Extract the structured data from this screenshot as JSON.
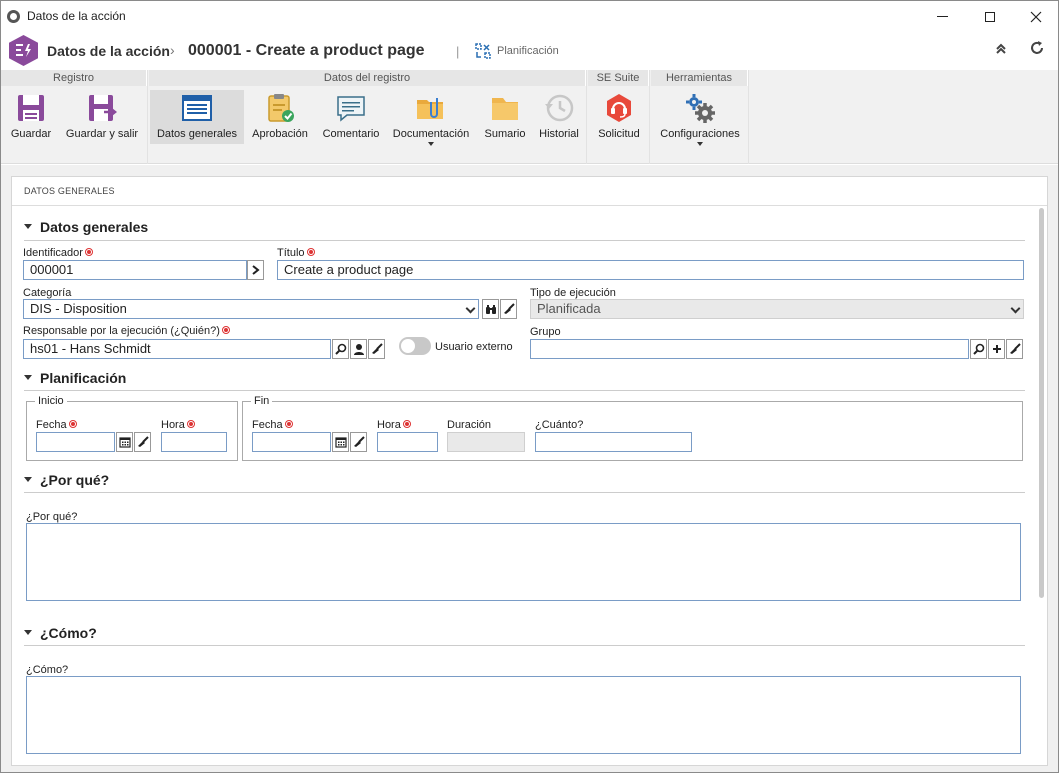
{
  "window": {
    "title": "Datos de la acción"
  },
  "header": {
    "crumb": "Datos de la acción",
    "record": "000001 - Create a product page",
    "status": "Planificación"
  },
  "ribbon": {
    "groups": [
      {
        "label": "Registro"
      },
      {
        "label": "Datos del registro"
      },
      {
        "label": "SE Suite"
      },
      {
        "label": "Herramientas"
      }
    ],
    "buttons": {
      "guardar": "Guardar",
      "guardar_salir": "Guardar y salir",
      "datos_generales": "Datos generales",
      "aprobacion": "Aprobación",
      "comentario": "Comentario",
      "documentacion": "Documentación",
      "sumario": "Sumario",
      "historial": "Historial",
      "solicitud": "Solicitud",
      "configuraciones": "Configuraciones"
    }
  },
  "panel": {
    "title": "DATOS GENERALES"
  },
  "sections": {
    "general": "Datos generales",
    "planning": "Planificación",
    "why": "¿Por qué?",
    "how": "¿Cómo?"
  },
  "fields": {
    "identificador": {
      "label": "Identificador",
      "value": "000001"
    },
    "titulo": {
      "label": "Título",
      "value": "Create a product page"
    },
    "categoria": {
      "label": "Categoría",
      "value": "DIS - Disposition"
    },
    "tipo": {
      "label": "Tipo de ejecución",
      "value": "Planificada"
    },
    "responsable": {
      "label": "Responsable por la ejecución (¿Quién?)",
      "value": "hs01 - Hans Schmidt"
    },
    "usuario_externo": {
      "label": "Usuario externo",
      "enabled": false
    },
    "grupo": {
      "label": "Grupo",
      "value": ""
    },
    "inicio": {
      "legend": "Inicio",
      "fecha_label": "Fecha",
      "hora_label": "Hora",
      "fecha": "",
      "hora": ""
    },
    "fin": {
      "legend": "Fin",
      "fecha_label": "Fecha",
      "hora_label": "Hora",
      "fecha": "",
      "hora": ""
    },
    "duracion": {
      "label": "Duración",
      "value": ""
    },
    "cuanto": {
      "label": "¿Cuánto?",
      "value": ""
    },
    "porque": {
      "label": "¿Por qué?",
      "value": ""
    },
    "como": {
      "label": "¿Cómo?",
      "value": ""
    }
  },
  "colors": {
    "accent": "#8a4a9b",
    "input_border": "#7a9cc6",
    "required": "#dd3333"
  }
}
